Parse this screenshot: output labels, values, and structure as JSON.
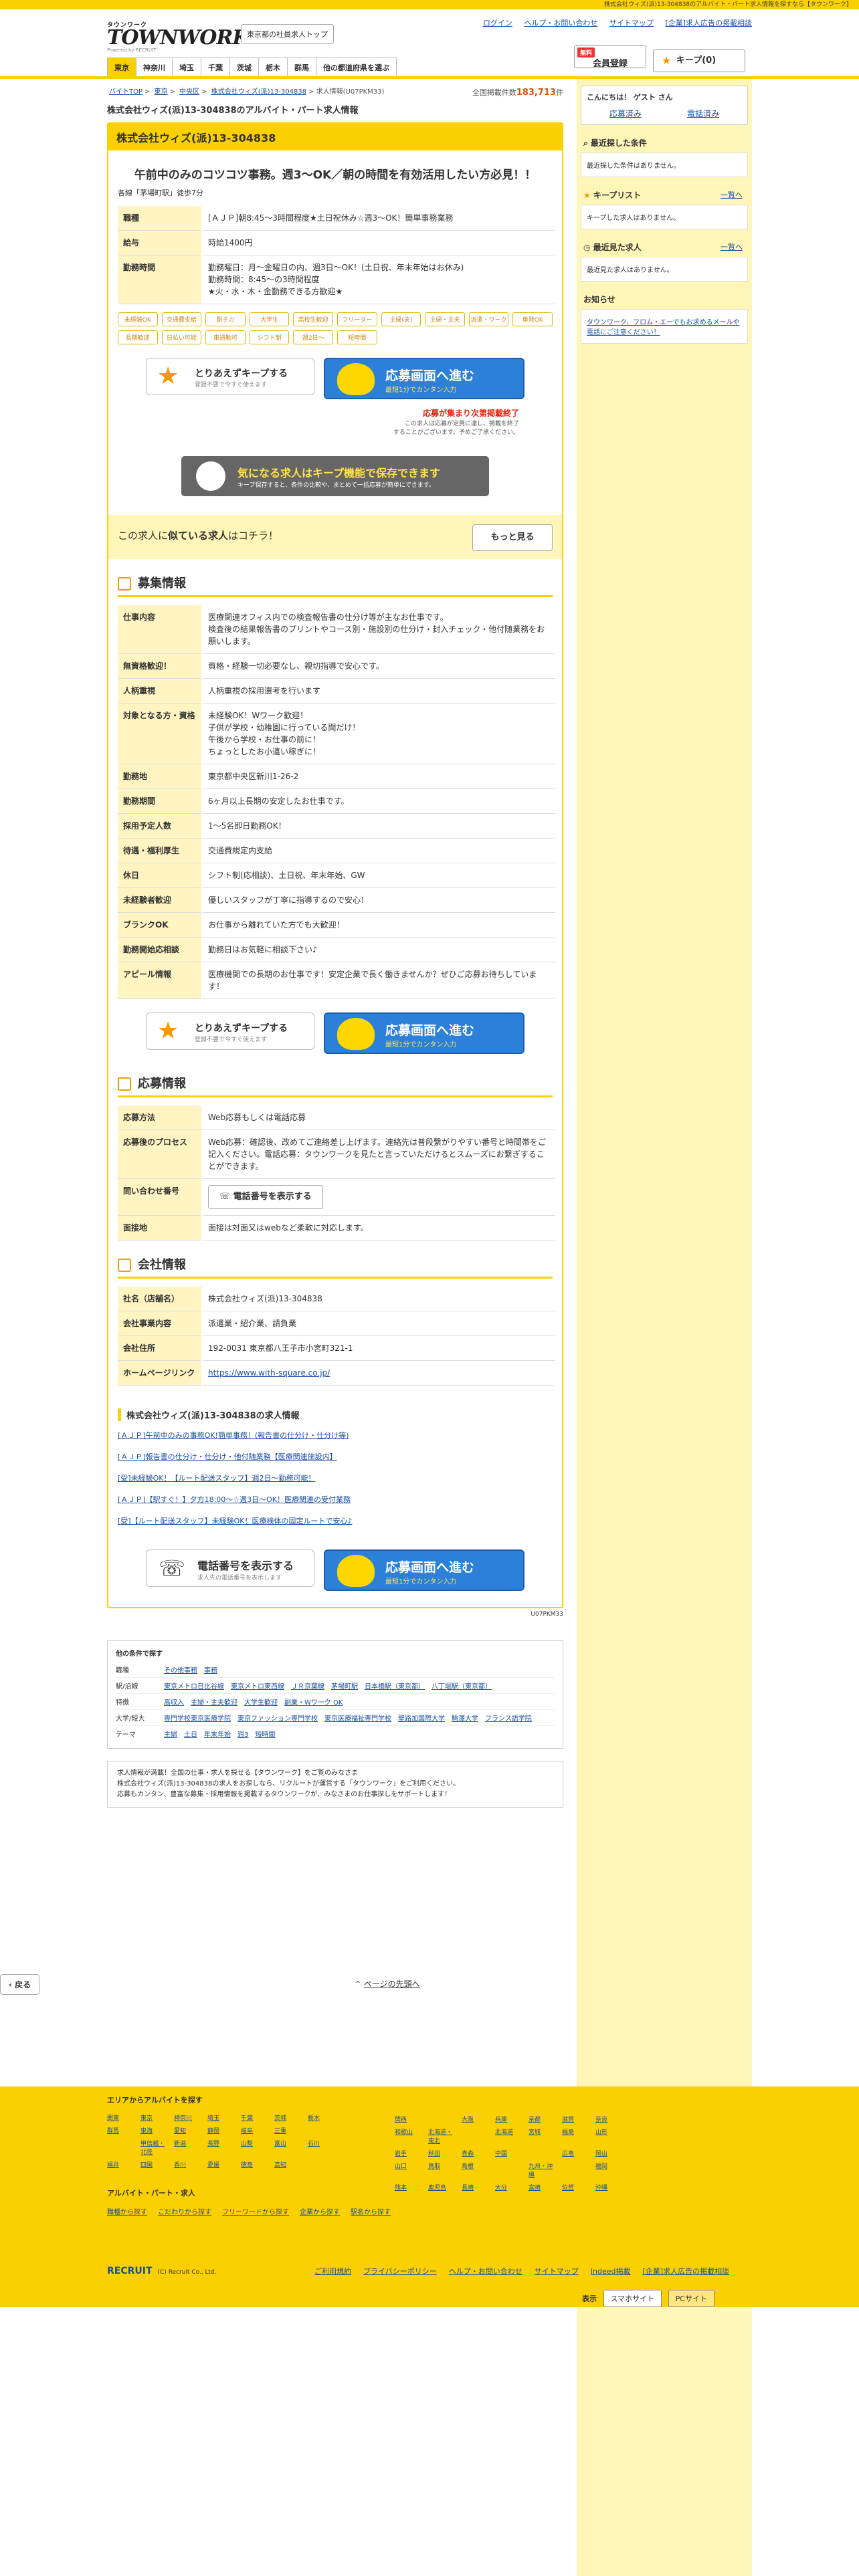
{
  "topbar": "株式会社ウィズ(派)13-304838のアルバイト・パート求人情報を探すなら【タウンワーク】",
  "header": {
    "logo_small": "タウンワーク",
    "logo_big": "TOWNWORK",
    "logo_sub": "Powered by RECRUIT",
    "area_button": "東京都の社員求人トップ",
    "links": [
      "ログイン",
      "ヘルプ・お問い合わせ",
      "サイトマップ",
      "[企業]求人広告の掲載相談"
    ],
    "member_free": "無料",
    "member": "会員登録",
    "keep": "キープ(0)"
  },
  "prefnav": [
    "東京",
    "神奈川",
    "埼玉",
    "千葉",
    "茨城",
    "栃木",
    "群馬",
    "他の都道府県を選ぶ"
  ],
  "breadcrumb": [
    "バイトTOP",
    ">",
    "東京",
    ">",
    "中央区",
    ">",
    "株式会社ウィズ(派)13-304838",
    ">",
    "求人情報(U07PKM33)"
  ],
  "total": {
    "label": "全国掲載件数",
    "count": "183,713",
    "unit": "件"
  },
  "page_title": "株式会社ウィズ(派)13-304838のアルバイト・パート求人情報",
  "company": "株式会社ウィズ(派)13-304838",
  "headline": "午前中のみのコツコツ事務。週3〜OK／朝の時間を有効活用したい方必見！！",
  "station": "各線「茅場町駅」徒歩7分",
  "summary": [
    {
      "k": "職種",
      "v": "[ＡＪＰ]朝8:45〜3時間程度★土日祝休み☆週3〜OK！簡単事務業務"
    },
    {
      "k": "給与",
      "v": "時給1400円"
    },
    {
      "k": "勤務時間",
      "v": "勤務曜日：月〜金曜日の内、週3日〜OK！(土日祝、年末年始はお休み)\n勤務時間：8:45〜の3時間程度\n★火・水・木・金勤務できる方歓迎★"
    }
  ],
  "tags": [
    "未経験OK",
    "交通費支給",
    "駅チカ",
    "大学生",
    "高校生歓迎",
    "フリーター",
    "主婦(夫)",
    "主婦・主夫",
    "派遣・ワーク",
    "単発OK",
    "長期歓迎",
    "日払い可能",
    "車通勤可",
    "シフト制",
    "週2日〜",
    "短時間"
  ],
  "keep_cta": {
    "title": "とりあえずキープする",
    "sub": "登録不要で今すぐ使えます"
  },
  "apply_cta": {
    "title": "応募画面へ進む",
    "sub": "最短1分でカンタン入力"
  },
  "deadline": {
    "title": "応募が集まり次第掲載終了",
    "note1": "この求人は応募が定員に達し、掲載を終了",
    "note2": "することがございます。予めご了承ください。"
  },
  "keep_banner": {
    "title": "気になる求人はキープ機能で保存できます",
    "sub": "キープ保存すると、条件の比較や、まとめて一括応募が簡単にできます。"
  },
  "similar": {
    "pre": "この求人に",
    "b": "似ている求人",
    "post": "はコチラ！",
    "more": "もっと見る"
  },
  "sec_recruit": "募集情報",
  "recruit": [
    {
      "k": "仕事内容",
      "v": "医療関連オフィス内での検査報告書の仕分け等が主なお仕事です。\n検査後の結果報告書のプリントやコース別・施設別の仕分け・封入チェック・他付随業務をお願いします。"
    },
    {
      "k": "無資格歓迎！",
      "v": "資格・経験一切必要なし、親切指導で安心です。"
    },
    {
      "k": "人柄重視",
      "v": "人柄重視の採用選考を行います"
    },
    {
      "k": "対象となる方・資格",
      "v": "未経験OK！Wワーク歓迎！\n子供が学校・幼稚園に行っている間だけ！\n午後から学校・お仕事の前に！\nちょっとしたお小遣い稼ぎに！"
    },
    {
      "k": "勤務地",
      "v": "東京都中央区新川1-26-2"
    },
    {
      "k": "勤務期間",
      "v": "6ヶ月以上長期の安定したお仕事です。"
    },
    {
      "k": "採用予定人数",
      "v": "1〜5名即日勤務OK！"
    },
    {
      "k": "待遇・福利厚生",
      "v": "交通費規定内支給"
    },
    {
      "k": "休日",
      "v": "シフト制(応相談)、土日祝、年末年始、GW"
    },
    {
      "k": "未経験者歓迎",
      "v": "優しいスタッフが丁寧に指導するので安心！"
    },
    {
      "k": "ブランクOK",
      "v": "お仕事から離れていた方でも大歓迎！"
    },
    {
      "k": "勤務開始応相談",
      "v": "勤務日はお気軽に相談下さい♪"
    },
    {
      "k": "アピール情報",
      "v": "医療機関での長期のお仕事です！安定企業で長く働きませんか？ぜひご応募お待ちしています！"
    }
  ],
  "sec_apply": "応募情報",
  "apply": [
    {
      "k": "応募方法",
      "v": "Web応募もしくは電話応募"
    },
    {
      "k": "応募後のプロセス",
      "v": "Web応募：確認後、改めてご連絡差し上げます。連絡先は普段繋がりやすい番号と時間帯をご記入ください。電話応募：タウンワークを見たと言っていただけるとスムーズにお繋ぎすることができます。"
    },
    {
      "k": "問い合わせ番号",
      "v": ""
    },
    {
      "k": "面接地",
      "v": "面接は対面又はwebなど柔軟に対応します。"
    }
  ],
  "tel_button": "電話番号を表示する",
  "sec_company": "会社情報",
  "companyinfo": [
    {
      "k": "社名（店舗名）",
      "v": "株式会社ウィズ(派)13-304838"
    },
    {
      "k": "会社事業内容",
      "v": "派遣業・紹介業、請負業"
    },
    {
      "k": "会社住所",
      "v": "192-0031 東京都八王子市小宮町321-1"
    },
    {
      "k": "ホームページリンク",
      "v": "https://www.with-square.co.jp/"
    }
  ],
  "company_jobs_h": "株式会社ウィズ(派)13-304838の求人情報",
  "company_jobs": [
    "[ＡＪＰ]午前中のみの事務OK!簡単事務！(報告書の仕分け・仕分け等)",
    "[ＡＪＰ]報告書の仕分け・仕分け・他付随業務【医療関連施設内】",
    "[受]未経験OK！【ルート配送スタッフ】週2日〜勤務可能！",
    "[ＡＪＰ]【駅すぐ！】夕方18:00〜☆週3日〜OK！医療関連の受付業務",
    "[受]【ルート配送スタッフ】未経験OK！医療検体の固定ルートで安心♪"
  ],
  "tel_cta": {
    "title": "電話番号を表示する",
    "sub": "求人先の電話番号を表示します"
  },
  "ref_id": "U07PKM33",
  "conds": {
    "title": "他の条件で探す",
    "rows": [
      {
        "k": "職種",
        "v": [
          "その他事務",
          "事務"
        ]
      },
      {
        "k": "駅/沿線",
        "v": [
          "東京メトロ日比谷線",
          "東京メトロ東西線",
          "ＪＲ京葉線",
          "茅場町駅",
          "日本橋駅（東京都）",
          "八丁堀駅（東京都）"
        ]
      },
      {
        "k": "特徴",
        "v": [
          "高収入",
          "主婦・主夫歓迎",
          "大学生歓迎",
          "副業・Wワーク OK"
        ]
      },
      {
        "k": "大学/短大",
        "v": [
          "専門学校東京医療学院",
          "東京ファッション専門学校",
          "東京医療福祉専門学校",
          "聖路加国際大学",
          "駒澤大学",
          "フランス語学院"
        ]
      },
      {
        "k": "テーマ",
        "v": [
          "主婦",
          "土日",
          "年末年始",
          "週3",
          "短時間"
        ]
      }
    ]
  },
  "message": "求人情報が満載！全国の仕事・求人を探せる【タウンワーク】をご覧のみなさま\n株式会社ウィズ(派)13-304838の求人をお探しなら、リクルートが運営する「タウンワーク」をご利用ください。\n応募もカンタン、豊富な募集・採用情報を掲載するタウンワークが、みなさまのお仕事探しをサポートします！",
  "back": "戻る",
  "pagetop": "ページの先頭へ",
  "sidebar": {
    "greeting": "こんにちは！ ゲスト さん",
    "login": "応募済み",
    "keepl": "電話済み",
    "recent_h": "最近探した条件",
    "recent_note": "最近探した条件はありません。",
    "keep_h": "キープリスト",
    "keep_more": "一覧へ",
    "keep_note": "キープした求人はありません。",
    "viewed_h": "最近見た求人",
    "viewed_more": "一覧へ",
    "viewed_note": "最近見た求人はありません。",
    "notice_h": "お知らせ",
    "notice": "タウンワーク、フロム・エーでもお求めるメールや電話にご注意ください！"
  },
  "footer": {
    "area_h": "エリアからアルバイトを探す",
    "left": [
      "関東",
      "東京",
      "神奈川",
      "埼玉",
      "千葉",
      "茨城",
      "栃木",
      "群馬",
      "東海",
      "愛知",
      "静岡",
      "岐阜",
      "三重",
      "",
      "",
      "甲信越・北陸",
      "新潟",
      "長野",
      "山梨",
      "富山",
      "石川",
      "福井",
      "四国",
      "香川",
      "愛媛",
      "徳島",
      "高知",
      "",
      ""
    ],
    "right": [
      "関西",
      "",
      "大阪",
      "兵庫",
      "京都",
      "滋賀",
      "奈良",
      "和歌山",
      "北海道・東北",
      "",
      "北海道",
      "宮城",
      "福島",
      "山形",
      "岩手",
      "秋田",
      "青森",
      "中国",
      "",
      "広島",
      "岡山",
      "山口",
      "鳥取",
      "島根",
      "",
      "九州・沖縄",
      "",
      "福岡",
      "熊本",
      "鹿児島",
      "長崎",
      "大分",
      "宮崎",
      "佐賀",
      "沖縄"
    ],
    "alba_h": "アルバイト・パート・求人",
    "alba_links": [
      "職種から探す",
      "こだわりから探す",
      "フリーワードから探す",
      "企業から探す",
      "駅名から探す"
    ],
    "recruit": "RECRUIT",
    "copyright": "(C) Recruit Co., Ltd.",
    "links": [
      "ご利用規約",
      "プライバシーポリシー",
      "ヘルプ・お問い合わせ",
      "サイトマップ",
      "Indeed掲載",
      "[企業]求人広告の掲載相談"
    ],
    "device_label": "表示",
    "device_sp": "スマホサイト",
    "device_pc": "PCサイト"
  }
}
